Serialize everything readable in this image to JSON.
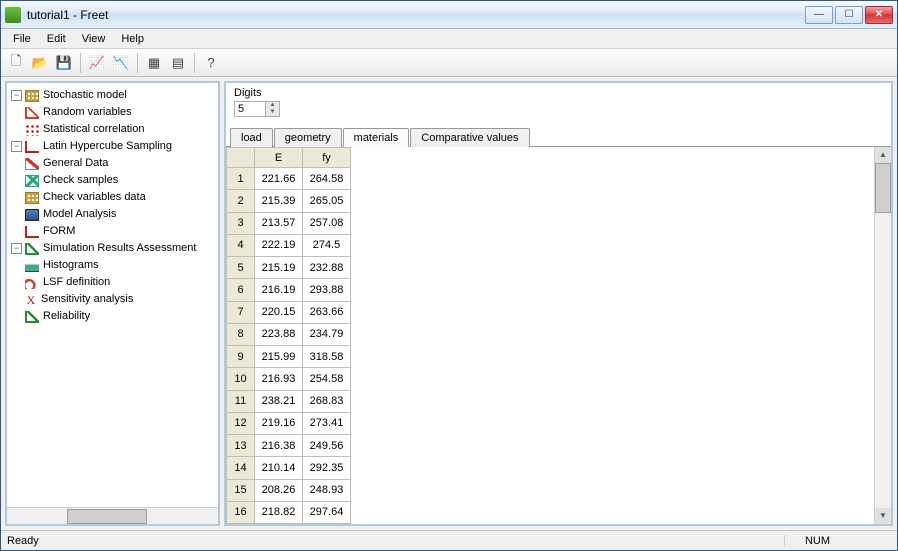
{
  "window": {
    "title": "tutorial1 - Freet"
  },
  "menu": {
    "file": "File",
    "edit": "Edit",
    "view": "View",
    "help": "Help"
  },
  "tree": {
    "stochastic": "Stochastic model",
    "random_vars": "Random variables",
    "stat_corr": "Statistical correlation",
    "lhs": "Latin Hypercube Sampling",
    "general_data": "General Data",
    "check_samples": "Check samples",
    "check_vars": "Check variables data",
    "model_analysis": "Model Analysis",
    "form": "FORM",
    "sim_results": "Simulation Results Assessment",
    "histograms": "Histograms",
    "lsf": "LSF definition",
    "sensitivity": "Sensitivity analysis",
    "reliability": "Reliability"
  },
  "digits": {
    "label": "Digits",
    "value": "5"
  },
  "tabs": {
    "load": "load",
    "geometry": "geometry",
    "materials": "materials",
    "comparative": "Comparative values"
  },
  "table": {
    "headers": {
      "c1": "E",
      "c2": "fy"
    },
    "rows": [
      {
        "n": "1",
        "E": "221.66",
        "fy": "264.58"
      },
      {
        "n": "2",
        "E": "215.39",
        "fy": "265.05"
      },
      {
        "n": "3",
        "E": "213.57",
        "fy": "257.08"
      },
      {
        "n": "4",
        "E": "222.19",
        "fy": "274.5"
      },
      {
        "n": "5",
        "E": "215.19",
        "fy": "232.88"
      },
      {
        "n": "6",
        "E": "216.19",
        "fy": "293.88"
      },
      {
        "n": "7",
        "E": "220.15",
        "fy": "263.66"
      },
      {
        "n": "8",
        "E": "223.88",
        "fy": "234.79"
      },
      {
        "n": "9",
        "E": "215.99",
        "fy": "318.58"
      },
      {
        "n": "10",
        "E": "216.93",
        "fy": "254.58"
      },
      {
        "n": "11",
        "E": "238.21",
        "fy": "268.83"
      },
      {
        "n": "12",
        "E": "219.16",
        "fy": "273.41"
      },
      {
        "n": "13",
        "E": "216.38",
        "fy": "249.56"
      },
      {
        "n": "14",
        "E": "210.14",
        "fy": "292.35"
      },
      {
        "n": "15",
        "E": "208.26",
        "fy": "248.93"
      },
      {
        "n": "16",
        "E": "218.82",
        "fy": "297.64"
      }
    ]
  },
  "status": {
    "ready": "Ready",
    "num": "NUM"
  }
}
